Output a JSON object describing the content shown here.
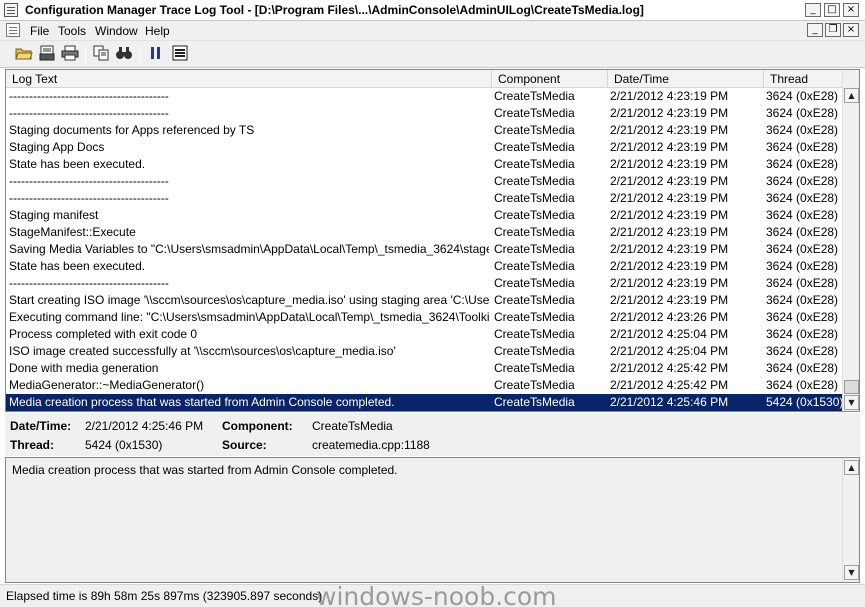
{
  "window": {
    "title": "Configuration Manager Trace Log Tool - [D:\\Program Files\\...\\AdminConsole\\AdminUILog\\CreateTsMedia.log]",
    "minimize": "_",
    "maximize": "□",
    "close": "×"
  },
  "menu": {
    "items": [
      "File",
      "Tools",
      "Window",
      "Help"
    ],
    "mdi_minimize": "_",
    "mdi_restore": "❐",
    "mdi_close": "×"
  },
  "toolbar": {
    "icons": [
      "open-folder-icon",
      "print-preview-icon",
      "print-icon",
      "copy-icon",
      "find-icon",
      "pause-icon",
      "highlight-icon"
    ]
  },
  "grid": {
    "columns": [
      "Log Text",
      "Component",
      "Date/Time",
      "Thread"
    ],
    "rows": [
      {
        "text": "----------------------------------------",
        "component": "CreateTsMedia",
        "datetime": "2/21/2012 4:23:19 PM",
        "thread": "3624 (0xE28)"
      },
      {
        "text": "----------------------------------------",
        "component": "CreateTsMedia",
        "datetime": "2/21/2012 4:23:19 PM",
        "thread": "3624 (0xE28)"
      },
      {
        "text": "Staging documents for Apps referenced by TS",
        "component": "CreateTsMedia",
        "datetime": "2/21/2012 4:23:19 PM",
        "thread": "3624 (0xE28)"
      },
      {
        "text": "Staging App Docs",
        "component": "CreateTsMedia",
        "datetime": "2/21/2012 4:23:19 PM",
        "thread": "3624 (0xE28)"
      },
      {
        "text": "State has been executed.",
        "component": "CreateTsMedia",
        "datetime": "2/21/2012 4:23:19 PM",
        "thread": "3624 (0xE28)"
      },
      {
        "text": "----------------------------------------",
        "component": "CreateTsMedia",
        "datetime": "2/21/2012 4:23:19 PM",
        "thread": "3624 (0xE28)"
      },
      {
        "text": "----------------------------------------",
        "component": "CreateTsMedia",
        "datetime": "2/21/2012 4:23:19 PM",
        "thread": "3624 (0xE28)"
      },
      {
        "text": "Staging manifest",
        "component": "CreateTsMedia",
        "datetime": "2/21/2012 4:23:19 PM",
        "thread": "3624 (0xE28)"
      },
      {
        "text": "StageManifest::Execute",
        "component": "CreateTsMedia",
        "datetime": "2/21/2012 4:23:19 PM",
        "thread": "3624 (0xE28)"
      },
      {
        "text": "Saving Media Variables to \"C:\\Users\\smsadmin\\AppData\\Local\\Temp\\_tsmedia_3624\\stage\\sms\\...",
        "component": "CreateTsMedia",
        "datetime": "2/21/2012 4:23:19 PM",
        "thread": "3624 (0xE28)"
      },
      {
        "text": "State has been executed.",
        "component": "CreateTsMedia",
        "datetime": "2/21/2012 4:23:19 PM",
        "thread": "3624 (0xE28)"
      },
      {
        "text": "----------------------------------------",
        "component": "CreateTsMedia",
        "datetime": "2/21/2012 4:23:19 PM",
        "thread": "3624 (0xE28)"
      },
      {
        "text": "Start creating ISO image '\\\\sccm\\sources\\os\\capture_media.iso' using staging area 'C:\\Users\\sms...",
        "component": "CreateTsMedia",
        "datetime": "2/21/2012 4:23:19 PM",
        "thread": "3624 (0xE28)"
      },
      {
        "text": "Executing command line: \"C:\\Users\\smsadmin\\AppData\\Local\\Temp\\_tsmedia_3624\\Toolkit\\SM...",
        "component": "CreateTsMedia",
        "datetime": "2/21/2012 4:23:26 PM",
        "thread": "3624 (0xE28)"
      },
      {
        "text": "Process completed with exit code 0",
        "component": "CreateTsMedia",
        "datetime": "2/21/2012 4:25:04 PM",
        "thread": "3624 (0xE28)"
      },
      {
        "text": "ISO image created successfully at '\\\\sccm\\sources\\os\\capture_media.iso'",
        "component": "CreateTsMedia",
        "datetime": "2/21/2012 4:25:04 PM",
        "thread": "3624 (0xE28)"
      },
      {
        "text": "Done with media generation",
        "component": "CreateTsMedia",
        "datetime": "2/21/2012 4:25:42 PM",
        "thread": "3624 (0xE28)"
      },
      {
        "text": "MediaGenerator::~MediaGenerator()",
        "component": "CreateTsMedia",
        "datetime": "2/21/2012 4:25:42 PM",
        "thread": "3624 (0xE28)"
      },
      {
        "text": "Media creation process that was started from Admin Console completed.",
        "component": "CreateTsMedia",
        "datetime": "2/21/2012 4:25:46 PM",
        "thread": "5424 (0x1530)",
        "selected": true
      }
    ]
  },
  "details": {
    "datetime_label": "Date/Time:",
    "datetime_value": "2/21/2012 4:25:46 PM",
    "component_label": "Component:",
    "component_value": "CreateTsMedia",
    "thread_label": "Thread:",
    "thread_value": "5424 (0x1530)",
    "source_label": "Source:",
    "source_value": "createmedia.cpp:1188"
  },
  "message": "Media creation process that was started from Admin Console completed.",
  "status": "Elapsed time is 89h 58m 25s 897ms (323905.897 seconds)",
  "watermark": "windows-noob.com",
  "colors": {
    "selection": "#0a246a"
  }
}
